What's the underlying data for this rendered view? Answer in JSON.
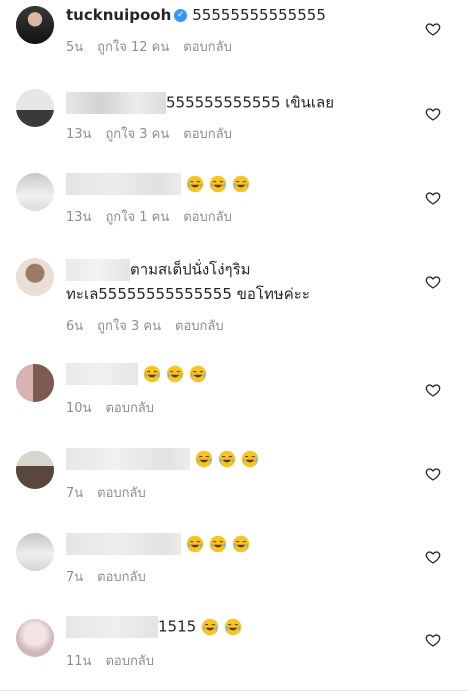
{
  "comments": [
    {
      "username": "tucknuipooh",
      "verified": true,
      "text": "55555555555555",
      "time": "5น",
      "likes": "ถูกใจ 12 คน",
      "reply": "ตอบกลับ",
      "emoji_count": 0
    },
    {
      "text": "555555555555 เขินเลย",
      "time": "13น",
      "likes": "ถูกใจ 3 คน",
      "reply": "ตอบกลับ",
      "emoji_count": 0
    },
    {
      "text": "",
      "time": "13น",
      "likes": "ถูกใจ 1 คน",
      "reply": "ตอบกลับ",
      "emoji_count": 3
    },
    {
      "text_line1": "ตามสเต็ปนั่งโง่ๆริม",
      "text_line2": "ทะเล55555555555555 ขอโทษค่ะะ",
      "time": "6น",
      "likes": "ถูกใจ 3 คน",
      "reply": "ตอบกลับ",
      "emoji_count": 0
    },
    {
      "text": "",
      "time": "10น",
      "reply": "ตอบกลับ",
      "emoji_count": 3
    },
    {
      "text": "",
      "time": "7น",
      "reply": "ตอบกลับ",
      "emoji_count": 3
    },
    {
      "text": "",
      "time": "7น",
      "reply": "ตอบกลับ",
      "emoji_count": 3
    },
    {
      "text": "1515",
      "time": "11น",
      "reply": "ตอบกลับ",
      "emoji_count": 2
    }
  ],
  "icons": {
    "like": "heart-outline-icon",
    "emoji": "face-with-tears-of-joy-emoji",
    "verified": "verified-badge-icon"
  },
  "colors": {
    "meta_text": "#8e8e8e",
    "verified_badge": "#3897f0",
    "emoji_face": "#f7c325"
  }
}
